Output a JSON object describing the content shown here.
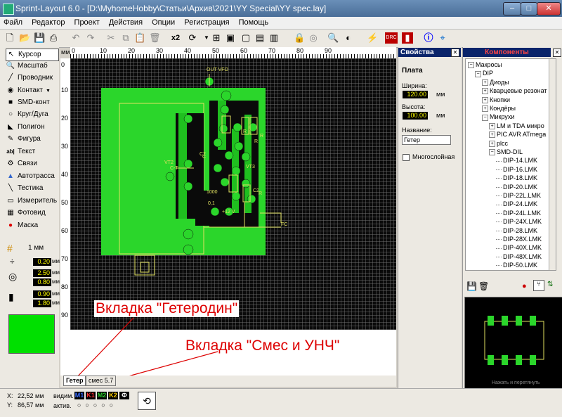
{
  "window": {
    "title": "Sprint-Layout 6.0 - [D:\\MyhomeHobby\\Статьи\\Архив\\2021\\YY Special\\YY spec.lay]",
    "min": "–",
    "max": "□",
    "close": "✕"
  },
  "menu": [
    "Файл",
    "Редактор",
    "Проект",
    "Действия",
    "Опции",
    "Регистрация",
    "Помощь"
  ],
  "toolbar": {
    "mirror": "x2",
    "icons": [
      "new-icon",
      "open-icon",
      "save-icon",
      "print-icon",
      "undo-icon",
      "redo-icon",
      "cut-icon",
      "copy-icon",
      "paste-icon",
      "delete-icon",
      "mirror-icon",
      "rotate-icon",
      "group-icon",
      "ungroup-icon",
      "zoom-icon",
      "contrast-icon",
      "drc-icon",
      "info-icon",
      "snap-icon"
    ]
  },
  "tools": [
    {
      "label": "Курсор",
      "icon": "cursor-icon"
    },
    {
      "label": "Масштаб",
      "icon": "zoom-icon"
    },
    {
      "label": "Проводник",
      "icon": "track-icon"
    },
    {
      "label": "Контакт",
      "icon": "pad-icon"
    },
    {
      "label": "SMD-конт",
      "icon": "smd-icon"
    },
    {
      "label": "Круг/Дуга",
      "icon": "circle-icon"
    },
    {
      "label": "Полигон",
      "icon": "polygon-icon"
    },
    {
      "label": "Фигура",
      "icon": "shape-icon"
    },
    {
      "label": "Текст",
      "icon": "text-icon"
    },
    {
      "label": "Связи",
      "icon": "link-icon"
    },
    {
      "label": "Автотрасса",
      "icon": "autoroute-icon"
    },
    {
      "label": "Тестика",
      "icon": "test-icon"
    },
    {
      "label": "Измеритель",
      "icon": "measure-icon"
    },
    {
      "label": "Фотовид",
      "icon": "photo-icon"
    },
    {
      "label": "Маска",
      "icon": "mask-icon"
    }
  ],
  "grid": {
    "label": "1 мм"
  },
  "widths": [
    {
      "value": "0.20",
      "unit": "мм"
    },
    {
      "value": "2.50",
      "unit": "мм"
    },
    {
      "value": "0.80",
      "unit": "мм"
    },
    {
      "value": "0.90",
      "unit": "мм"
    },
    {
      "value": "1.80",
      "unit": "мм"
    }
  ],
  "ruler": {
    "unit": "мм",
    "top": [
      "0",
      "10",
      "20",
      "30",
      "40",
      "50",
      "60",
      "70",
      "80",
      "90"
    ],
    "left": [
      "0",
      "10",
      "20",
      "30",
      "40",
      "50",
      "60",
      "70",
      "80",
      "90"
    ]
  },
  "board_labels": [
    "OUT VFO",
    "C-T",
    "R",
    "R",
    "C",
    "R",
    "VT3",
    "C2",
    "VT2",
    "C2",
    "1000",
    "0,1",
    "R",
    "+12 V",
    "FC"
  ],
  "annotations": {
    "geterodin": "Вкладка \"Гетеродин\"",
    "smes": "Вкладка \"Смес и УНЧ\""
  },
  "properties": {
    "title": "Свойства",
    "section": "Плата",
    "width_label": "Ширина:",
    "width": "120.00",
    "width_unit": "мм",
    "height_label": "Высота:",
    "height": "100.00",
    "height_unit": "мм",
    "name_label": "Название:",
    "name": "Гетер",
    "multilayer": "Многослойная"
  },
  "components": {
    "title": "Компоненты",
    "tree": [
      {
        "label": "Макросы",
        "depth": 0,
        "pm": "−"
      },
      {
        "label": "DIP",
        "depth": 1,
        "pm": "−"
      },
      {
        "label": "Диоды",
        "depth": 2,
        "pm": "+"
      },
      {
        "label": "Кварцевые резонат",
        "depth": 2,
        "pm": "+"
      },
      {
        "label": "Кнопки",
        "depth": 2,
        "pm": "+"
      },
      {
        "label": "Кондёры",
        "depth": 2,
        "pm": "+"
      },
      {
        "label": "Микрухи",
        "depth": 2,
        "pm": "−"
      },
      {
        "label": "LM и TDA микро",
        "depth": 3,
        "pm": "+"
      },
      {
        "label": "PIC AVR ATmega",
        "depth": 3,
        "pm": "+"
      },
      {
        "label": "plcc",
        "depth": 3,
        "pm": "+"
      },
      {
        "label": "SMD-DIL",
        "depth": 3,
        "pm": "−"
      },
      {
        "label": "DIP-14.LMK",
        "depth": 4,
        "pm": ""
      },
      {
        "label": "DIP-16.LMK",
        "depth": 4,
        "pm": ""
      },
      {
        "label": "DIP-18.LMK",
        "depth": 4,
        "pm": ""
      },
      {
        "label": "DIP-20.LMK",
        "depth": 4,
        "pm": ""
      },
      {
        "label": "DIP-22L.LMK",
        "depth": 4,
        "pm": ""
      },
      {
        "label": "DIP-24.LMK",
        "depth": 4,
        "pm": ""
      },
      {
        "label": "DIP-24L.LMK",
        "depth": 4,
        "pm": ""
      },
      {
        "label": "DIP-24X.LMK",
        "depth": 4,
        "pm": ""
      },
      {
        "label": "DIP-28.LMK",
        "depth": 4,
        "pm": ""
      },
      {
        "label": "DIP-28X.LMK",
        "depth": 4,
        "pm": ""
      },
      {
        "label": "DIP-40X.LMK",
        "depth": 4,
        "pm": ""
      },
      {
        "label": "DIP-48X.LMK",
        "depth": 4,
        "pm": ""
      },
      {
        "label": "DIP-50.LMK",
        "depth": 4,
        "pm": ""
      }
    ],
    "preview_hint": "Нажать и перетянуть"
  },
  "tabs": [
    "Гетер",
    "смес 5.7"
  ],
  "status": {
    "x_label": "X:",
    "x": "22,52 мм",
    "y_label": "Y:",
    "y": "86,57 мм",
    "visible": "видим.",
    "active": "актив.",
    "layers": [
      {
        "label": "M1",
        "color": "#3a6cff"
      },
      {
        "label": "K1",
        "color": "#ff3030"
      },
      {
        "label": "M2",
        "color": "#30d030"
      },
      {
        "label": "K2",
        "color": "#ffd000"
      },
      {
        "label": "Ф",
        "color": "#ffffff"
      }
    ]
  },
  "colors": {
    "accent": "#00e000",
    "board": "#2bd62b",
    "copper": "#1fbf1f"
  }
}
